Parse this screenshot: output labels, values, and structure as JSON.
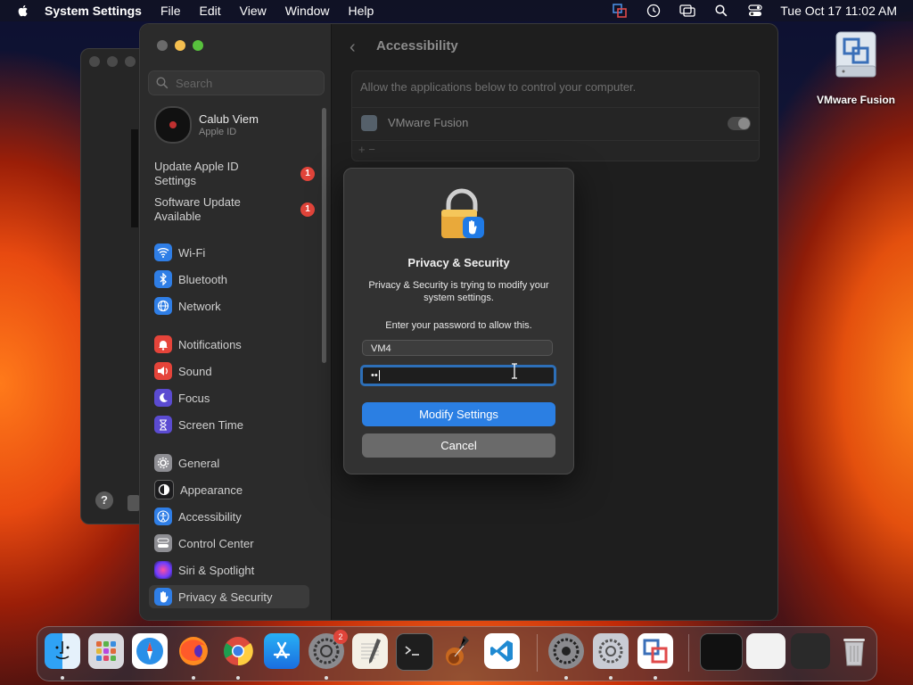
{
  "menubar": {
    "app_name": "System Settings",
    "menus": [
      "File",
      "Edit",
      "View",
      "Window",
      "Help"
    ],
    "clock": "Tue Oct 17  11:02 AM"
  },
  "sidebar": {
    "search_placeholder": "Search",
    "user": {
      "name": "Calub Viem",
      "subtitle": "Apple ID"
    },
    "notices": [
      {
        "label": "Update Apple ID Settings",
        "badge": "1"
      },
      {
        "label": "Software Update Available",
        "badge": "1"
      }
    ],
    "items": [
      {
        "label": "Wi-Fi",
        "icon": "wifi-icon",
        "color": "#2f7ee6"
      },
      {
        "label": "Bluetooth",
        "icon": "bluetooth-icon",
        "color": "#2f7ee6"
      },
      {
        "label": "Network",
        "icon": "globe-icon",
        "color": "#2f7ee6"
      },
      {
        "label": "Notifications",
        "icon": "bell-icon",
        "color": "#e5443a"
      },
      {
        "label": "Sound",
        "icon": "speaker-icon",
        "color": "#e5443a"
      },
      {
        "label": "Focus",
        "icon": "moon-icon",
        "color": "#5b4bd1"
      },
      {
        "label": "Screen Time",
        "icon": "hourglass-icon",
        "color": "#5b4bd1"
      },
      {
        "label": "General",
        "icon": "gear-icon",
        "color": "#8e8e93"
      },
      {
        "label": "Appearance",
        "icon": "appearance-icon",
        "color": "#1c1c1e"
      },
      {
        "label": "Accessibility",
        "icon": "accessibility-icon",
        "color": "#2f7ee6"
      },
      {
        "label": "Control Center",
        "icon": "control-center-icon",
        "color": "#8e8e93"
      },
      {
        "label": "Siri & Spotlight",
        "icon": "siri-icon",
        "color": "#b0368f"
      },
      {
        "label": "Privacy & Security",
        "icon": "hand-icon",
        "color": "#2f7ee6",
        "selected": true
      }
    ]
  },
  "content": {
    "title": "Accessibility",
    "hint": "Allow the applications below to control your computer.",
    "apps": [
      {
        "name": "VMware Fusion",
        "enabled": true
      }
    ],
    "add_remove": "+  −"
  },
  "dialog": {
    "title": "Privacy & Security",
    "message": "Privacy & Security is trying to modify your system settings.",
    "prompt": "Enter your password to allow this.",
    "username": "VM4",
    "password_mask": "••",
    "primary_button": "Modify Settings",
    "secondary_button": "Cancel"
  },
  "desktop": {
    "icon_label": "VMware Fusion"
  },
  "dock": {
    "apps": [
      "Finder",
      "Launchpad",
      "Safari",
      "Firefox",
      "Chrome",
      "App Store",
      "System Settings",
      "TextEdit",
      "Terminal",
      "GarageBand",
      "VS Code",
      "System Preferences",
      "System Settings",
      "VMware Fusion"
    ],
    "settings_badge": "2"
  }
}
